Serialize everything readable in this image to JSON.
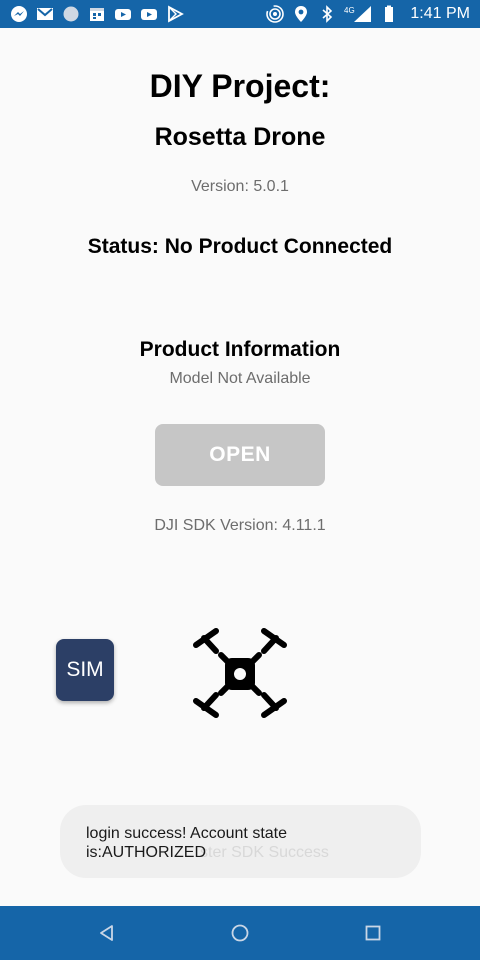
{
  "status_bar": {
    "time": "1:41 PM",
    "network": "4G",
    "left_icons": [
      "messenger-icon",
      "gmail-icon",
      "circle-app-icon",
      "calendar-icon",
      "youtube-icon",
      "youtube-icon",
      "play-store-icon"
    ],
    "right_icons": [
      "hotspot-icon",
      "location-icon",
      "bluetooth-icon",
      "signal-icon",
      "battery-icon"
    ],
    "color": "#1565a8"
  },
  "header": {
    "title": "DIY Project:",
    "subtitle": "Rosetta Drone",
    "version": "Version: 5.0.1"
  },
  "status": {
    "text": "Status: No Product Connected"
  },
  "product": {
    "heading": "Product Information",
    "model": "Model Not Available"
  },
  "open_button": {
    "label": "OPEN",
    "color": "#c6c6c6"
  },
  "sdk": {
    "version": "DJI SDK Version: 4.11.1"
  },
  "sim_button": {
    "label": "SIM",
    "color": "#2c3f66"
  },
  "drone_icon": "drone-icon",
  "toast": {
    "message": "login success! Account state is:AUTHORIZED",
    "ghost_text": "ster SDK Success"
  },
  "nav_bar": {
    "buttons": [
      "back-icon",
      "home-icon",
      "recents-icon"
    ],
    "color": "#1565a8"
  }
}
